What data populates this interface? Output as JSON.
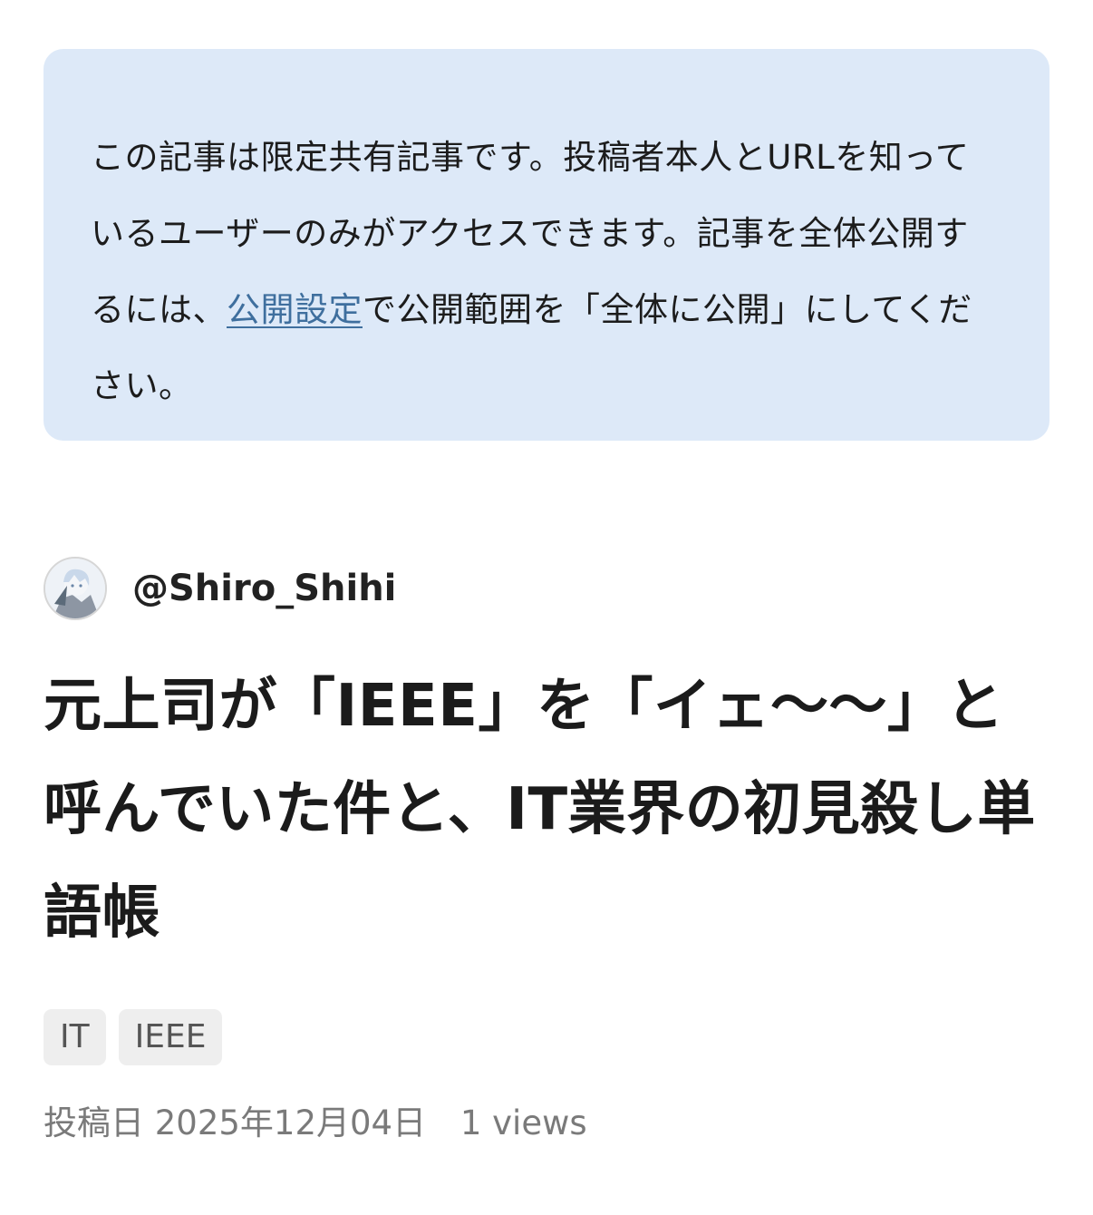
{
  "notice": {
    "text_before_link": "この記事は限定共有記事です。投稿者本人とURLを知っているユーザーのみがアクセスできます。記事を全体公開するには、",
    "link_label": "公開設定",
    "text_after_link": "で公開範囲を「全体に公開」にしてください。",
    "background_color": "#dde9f8",
    "link_color": "#3f6f9e"
  },
  "author": {
    "avatar_icon": "avatar-illustration-icon",
    "handle": "@Shiro_Shihi"
  },
  "article": {
    "title": "元上司が「IEEE」を「イェ〜〜」と呼んでいた件と、IT業界の初見殺し単語帳",
    "tags": [
      {
        "label": "IT"
      },
      {
        "label": "IEEE"
      }
    ],
    "posted_label": "投稿日",
    "posted_date": "2025年12月04日",
    "views": "1 views"
  }
}
